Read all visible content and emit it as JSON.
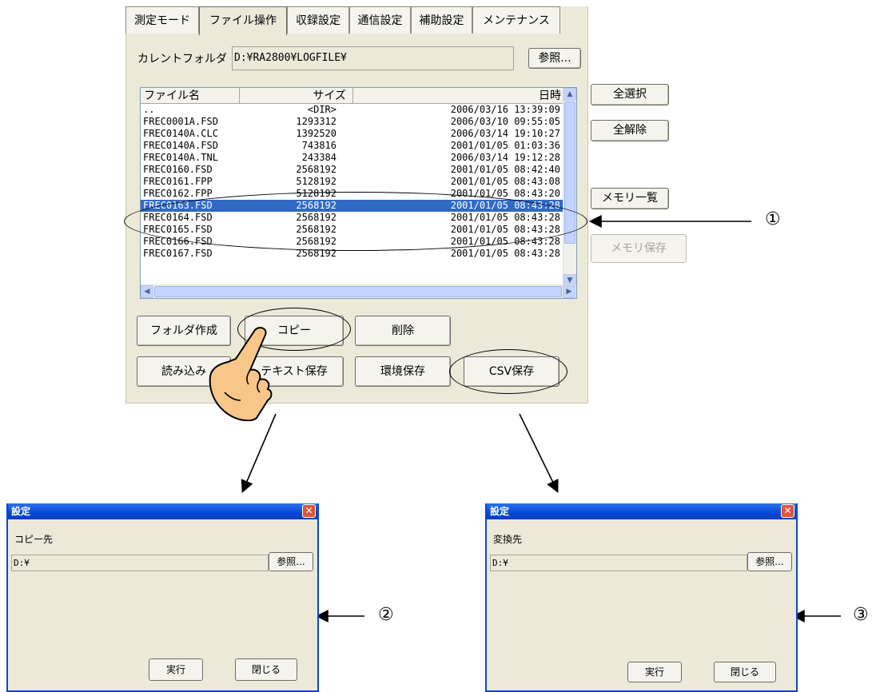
{
  "tabs": [
    "測定モード",
    "ファイル操作",
    "収録設定",
    "通信設定",
    "補助設定",
    "メンテナンス"
  ],
  "current_folder": {
    "label": "カレントフォルダ",
    "value": "D:¥RA2800¥LOGFILE¥",
    "browse": "参照..."
  },
  "file_list": {
    "columns": [
      "ファイル名",
      "サイズ",
      "日時"
    ],
    "rows": [
      [
        "..",
        "<DIR>",
        "2006/03/16 13:39:09"
      ],
      [
        "FREC0001A.FSD",
        "1293312",
        "2006/03/10 09:55:05"
      ],
      [
        "FREC0140A.CLC",
        "1392520",
        "2006/03/14 19:10:27"
      ],
      [
        "FREC0140A.FSD",
        "743816",
        "2001/01/05 01:03:36"
      ],
      [
        "FREC0140A.TNL",
        "243384",
        "2006/03/14 19:12:28"
      ],
      [
        "FREC0160.FSD",
        "2568192",
        "2001/01/05 08:42:40"
      ],
      [
        "FREC0161.FPP",
        "5128192",
        "2001/01/05 08:43:08"
      ],
      [
        "FREC0162.FPP",
        "5128192",
        "2001/01/05 08:43:20"
      ],
      [
        "FREC0163.FSD",
        "2568192",
        "2001/01/05 08:43:28"
      ],
      [
        "FREC0164.FSD",
        "2568192",
        "2001/01/05 08:43:28"
      ],
      [
        "FREC0165.FSD",
        "2568192",
        "2001/01/05 08:43:28"
      ],
      [
        "FREC0166.FSD",
        "2568192",
        "2001/01/05 08:43:28"
      ],
      [
        "FREC0167.FSD",
        "2568192",
        "2001/01/05 08:43:28"
      ]
    ],
    "selected_index": 8
  },
  "side_buttons": {
    "select_all": "全選択",
    "deselect_all": "全解除",
    "memory_list": "メモリ一覧",
    "memory_save": "メモリ保存"
  },
  "action_buttons": {
    "create_folder": "フォルダ作成",
    "copy": "コピー",
    "delete": "削除",
    "load": "読み込み",
    "text_save": "テキスト保存",
    "env_save": "環境保存",
    "csv_save": "CSV保存"
  },
  "callouts": [
    "①",
    "②",
    "③"
  ],
  "copy_dialog": {
    "title": "設定",
    "label": "コピー先",
    "path": "D:¥",
    "browse": "参照...",
    "execute": "実行",
    "close": "閉じる"
  },
  "csv_dialog": {
    "title": "設定",
    "label": "変換先",
    "path": "D:¥",
    "browse": "参照...",
    "execute": "実行",
    "close": "閉じる"
  },
  "colors": {
    "selection": "#316ac5",
    "panel": "#ece9d8",
    "title_bar": "#0548d4"
  },
  "icons": [
    "hand-pointer-icon",
    "close-icon",
    "arrow-left-icon",
    "scroll-up-icon",
    "scroll-down-icon",
    "scroll-left-icon",
    "scroll-right-icon"
  ]
}
